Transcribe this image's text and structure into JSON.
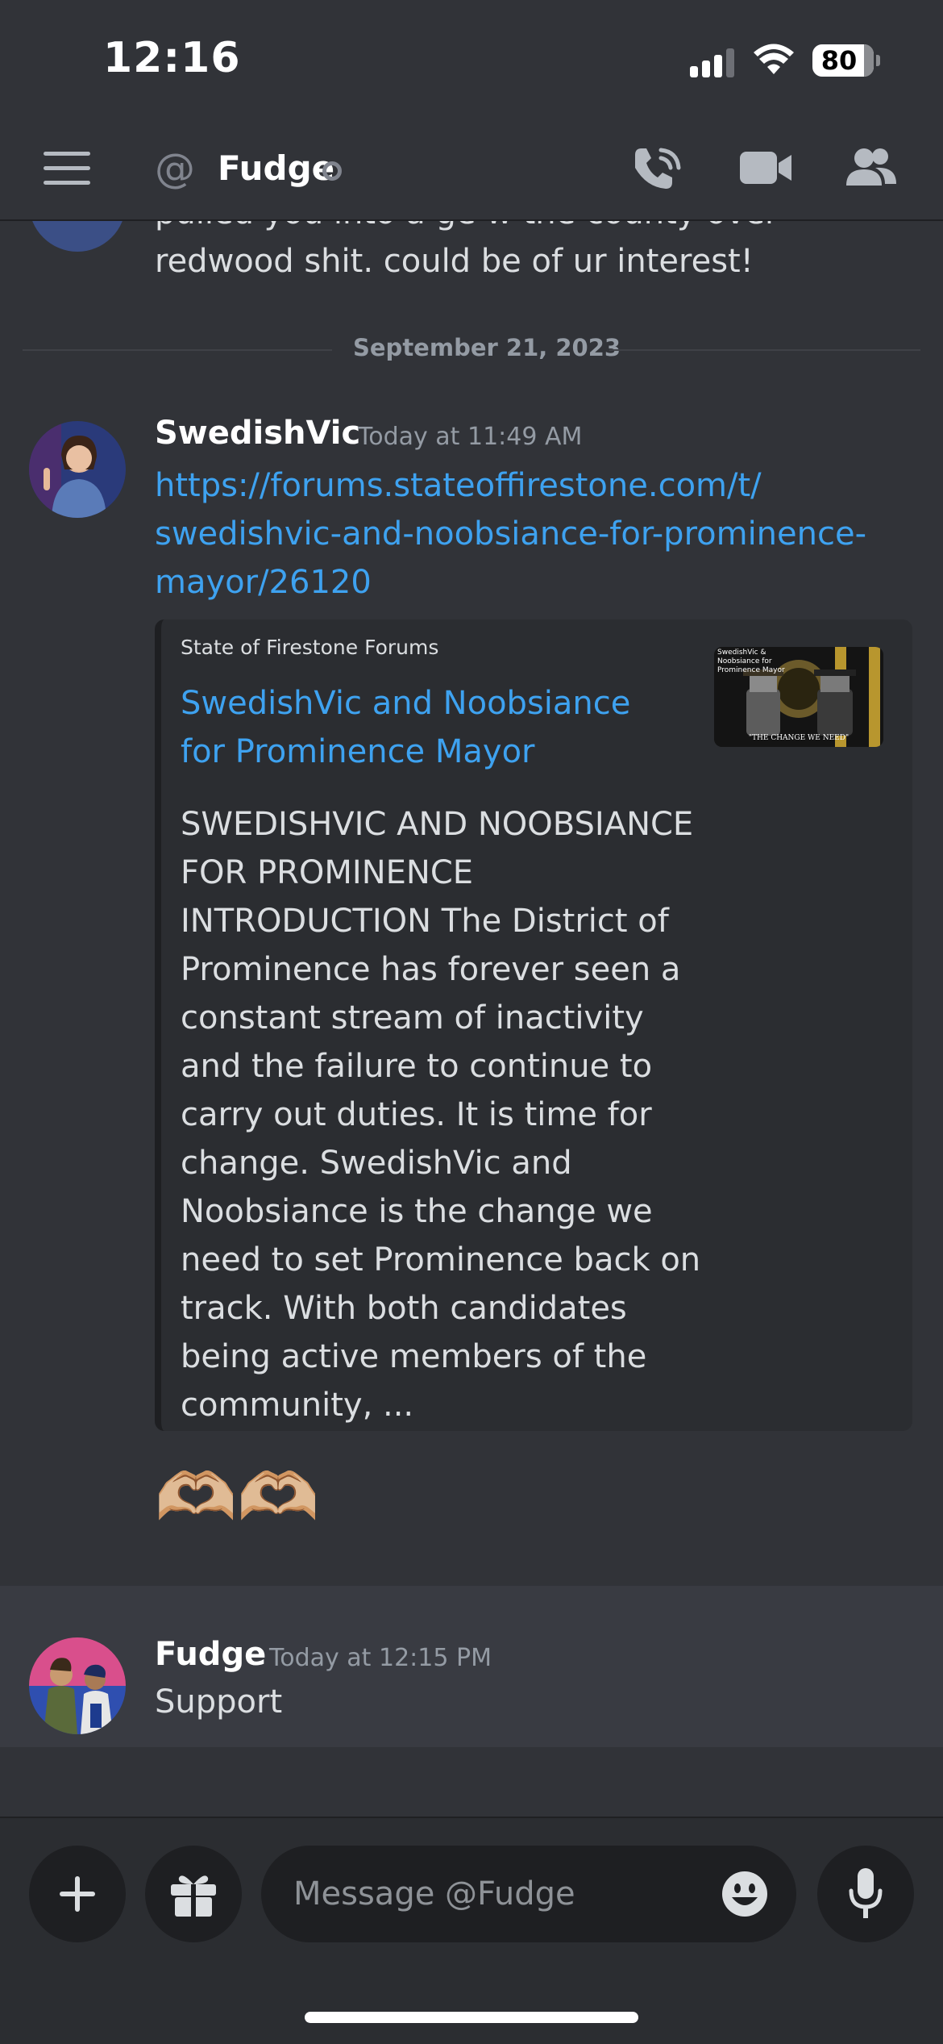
{
  "status_bar": {
    "time": "12:16",
    "battery": "80"
  },
  "header": {
    "title": "Fudge"
  },
  "messages": [
    {
      "text": "pulled you into a ge w the county over redwood shit. could be of ur interest!"
    },
    {
      "divider": "September 21, 2023"
    },
    {
      "author": "SwedishVic",
      "timestamp": "Today at 11:49 AM",
      "link": "https://forums.stateoffirestone.com/t/swedishvic-and-noobsiance-for-prominence-mayor/26120",
      "link_lines": [
        "https://forums.stateoffirestone.com/t/",
        "swedishvic-and-noobsiance-for-prominence-",
        "mayor/26120"
      ],
      "embed": {
        "provider": "State of Firestone Forums",
        "title": "SwedishVic and Noobsiance for Prominence Mayor",
        "description": "SWEDISHVIC AND NOOBSIANCE FOR PROMINENCE INTRODUCTION  The District of Prominence has forever seen a constant stream of inactivity and the failure to continue to carry out duties. It is time for change. SwedishVic and Noobsiance is the change we need to set Prominence back on track. With both candidates being active members of the community, ...",
        "thumbnail_caption": "SwedishVic & Noobsiance for Prominence Mayor",
        "thumbnail_tagline": "\"THE CHANGE WE NEED\""
      },
      "reaction": "🫶🏼🫶🏼"
    },
    {
      "author": "Fudge",
      "timestamp": "Today at 12:15 PM",
      "text": "Support"
    }
  ],
  "composer": {
    "placeholder": "Message @Fudge"
  },
  "colors": {
    "link": "#3ea2f0",
    "background": "#313338",
    "highlight": "#393b42"
  }
}
